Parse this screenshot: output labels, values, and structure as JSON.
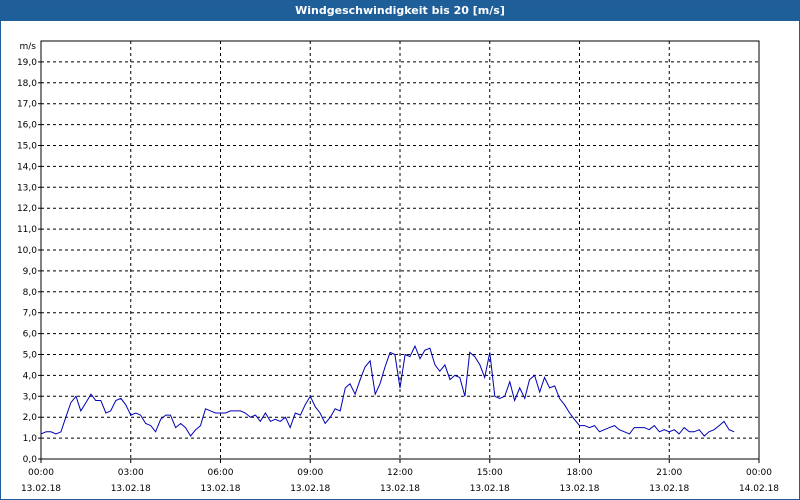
{
  "window": {
    "title": "Windgeschwindigkeit bis 20 [m/s]"
  },
  "colors": {
    "series": "#0000b4",
    "grid": "#000000",
    "title_bg": "#1f5f99"
  },
  "chart_data": {
    "type": "line",
    "title": "Windgeschwindigkeit bis 20 [m/s]",
    "ylabel": "m/s",
    "ylim": [
      0,
      20
    ],
    "yticks": [
      "0,0",
      "1,0",
      "2,0",
      "3,0",
      "4,0",
      "5,0",
      "6,0",
      "7,0",
      "8,0",
      "9,0",
      "10,0",
      "11,0",
      "12,0",
      "13,0",
      "14,0",
      "15,0",
      "16,0",
      "17,0",
      "18,0",
      "19,0"
    ],
    "xlim": [
      0,
      24
    ],
    "xticks": [
      {
        "time": "00:00",
        "date": "13.02.18"
      },
      {
        "time": "03:00",
        "date": "13.02.18"
      },
      {
        "time": "06:00",
        "date": "13.02.18"
      },
      {
        "time": "09:00",
        "date": "13.02.18"
      },
      {
        "time": "12:00",
        "date": "13.02.18"
      },
      {
        "time": "15:00",
        "date": "13.02.18"
      },
      {
        "time": "18:00",
        "date": "13.02.18"
      },
      {
        "time": "21:00",
        "date": "13.02.18"
      },
      {
        "time": "00:00",
        "date": "14.02.18"
      }
    ],
    "grid": true,
    "x": [
      0,
      0.17,
      0.33,
      0.5,
      0.67,
      0.83,
      1.0,
      1.17,
      1.33,
      1.5,
      1.67,
      1.83,
      2.0,
      2.17,
      2.33,
      2.5,
      2.67,
      2.83,
      3.0,
      3.17,
      3.33,
      3.5,
      3.67,
      3.83,
      4.0,
      4.17,
      4.33,
      4.5,
      4.67,
      4.83,
      5.0,
      5.17,
      5.33,
      5.5,
      5.67,
      5.83,
      6.0,
      6.17,
      6.33,
      6.5,
      6.67,
      6.83,
      7.0,
      7.17,
      7.33,
      7.5,
      7.67,
      7.83,
      8.0,
      8.17,
      8.33,
      8.5,
      8.67,
      8.83,
      9.0,
      9.17,
      9.33,
      9.5,
      9.67,
      9.83,
      10.0,
      10.17,
      10.33,
      10.5,
      10.67,
      10.83,
      11.0,
      11.17,
      11.33,
      11.5,
      11.67,
      11.83,
      12.0,
      12.17,
      12.33,
      12.5,
      12.67,
      12.83,
      13.0,
      13.17,
      13.33,
      13.5,
      13.67,
      13.83,
      14.0,
      14.17,
      14.33,
      14.5,
      14.67,
      14.83,
      15.0,
      15.17,
      15.33,
      15.5,
      15.67,
      15.83,
      16.0,
      16.17,
      16.33,
      16.5,
      16.67,
      16.83,
      17.0,
      17.17,
      17.33,
      17.5,
      17.67,
      17.83,
      18.0,
      18.17,
      18.33,
      18.5,
      18.67,
      18.83,
      19.0,
      19.17,
      19.33,
      19.5,
      19.67,
      19.83,
      20.0,
      20.17,
      20.33,
      20.5,
      20.67,
      20.83,
      21.0,
      21.17,
      21.33,
      21.5,
      21.67,
      21.83,
      22.0,
      22.17,
      22.33,
      22.5,
      22.67,
      22.83,
      23.0,
      23.17,
      23.33,
      23.5,
      23.67,
      23.83
    ],
    "series": [
      {
        "values": [
          1.2,
          1.3,
          1.3,
          1.2,
          1.3,
          2.0,
          2.7,
          3.0,
          2.3,
          2.7,
          3.1,
          2.8,
          2.8,
          2.2,
          2.3,
          2.8,
          2.9,
          2.6,
          2.1,
          2.2,
          2.1,
          1.7,
          1.6,
          1.3,
          1.9,
          2.1,
          2.1,
          1.5,
          1.7,
          1.5,
          1.1,
          1.4,
          1.6,
          2.4,
          2.3,
          2.2,
          2.2,
          2.2,
          2.3,
          2.3,
          2.3,
          2.2,
          2.0,
          2.1,
          1.8,
          2.2,
          1.8,
          1.9,
          1.8,
          2.0,
          1.5,
          2.2,
          2.1,
          2.6,
          3.0,
          2.5,
          2.2,
          1.7,
          2.0,
          2.4,
          2.3,
          3.4,
          3.6,
          3.1,
          3.8,
          4.4,
          4.7,
          3.1,
          3.6,
          4.4,
          5.1,
          5.0,
          3.4,
          5.0,
          4.9,
          5.4,
          4.8,
          5.2,
          5.3,
          4.5,
          4.2,
          4.5,
          3.8,
          4.0,
          3.9,
          3.0,
          5.1,
          4.9,
          4.5,
          3.9,
          5.1,
          3.0,
          2.9,
          3.0,
          3.7,
          2.8,
          3.4,
          2.9,
          3.8,
          4.0,
          3.2,
          3.9,
          3.4,
          3.5,
          2.9,
          2.6,
          2.2,
          1.9,
          1.6,
          1.6,
          1.5,
          1.6,
          1.3,
          1.4,
          1.5,
          1.6,
          1.4,
          1.3,
          1.2,
          1.5,
          1.5,
          1.5,
          1.4,
          1.6,
          1.3,
          1.4,
          1.3,
          1.4,
          1.2,
          1.5,
          1.3,
          1.3,
          1.4,
          1.1,
          1.3,
          1.4,
          1.6,
          1.8,
          1.4,
          1.3
        ]
      }
    ]
  }
}
